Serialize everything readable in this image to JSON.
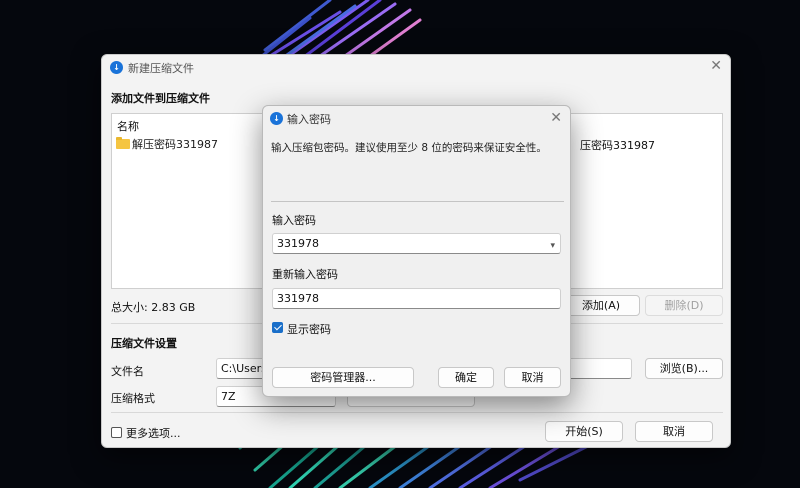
{
  "main_window": {
    "title": "新建压缩文件",
    "add_section_label": "添加文件到压缩文件",
    "file_list": {
      "column_header": "名称",
      "items": [
        {
          "name": "解压密码331987",
          "type": "folder"
        }
      ],
      "partially_visible_text": "压密码331987"
    },
    "total_size": "总大小: 2.83 GB",
    "add_button": "添加(A)",
    "delete_button": "删除(D)",
    "settings_section_label": "压缩文件设置",
    "filename_label": "文件名",
    "filename_value": "C:\\Users\\",
    "browse_button": "浏览(B)...",
    "format_label": "压缩格式",
    "format_value": "7Z",
    "more_options_label": "更多选项...",
    "start_button": "开始(S)",
    "cancel_button": "取消"
  },
  "password_dialog": {
    "title": "输入密码",
    "hint": "输入压缩包密码。建议使用至少 8 位的密码来保证安全性。",
    "password_label": "输入密码",
    "password_value": "331978",
    "confirm_label": "重新输入密码",
    "confirm_value": "331978",
    "show_password_label": "显示密码",
    "show_password_checked": true,
    "manager_button": "密码管理器...",
    "ok_button": "确定",
    "cancel_button": "取消"
  },
  "icons": {
    "app": "app-logo-icon",
    "close": "close-icon",
    "folder": "folder-icon",
    "dropdown": "chevron-down-icon"
  },
  "colors": {
    "accent": "#1a6fc9",
    "wallpaper_bg": "#05070d"
  }
}
